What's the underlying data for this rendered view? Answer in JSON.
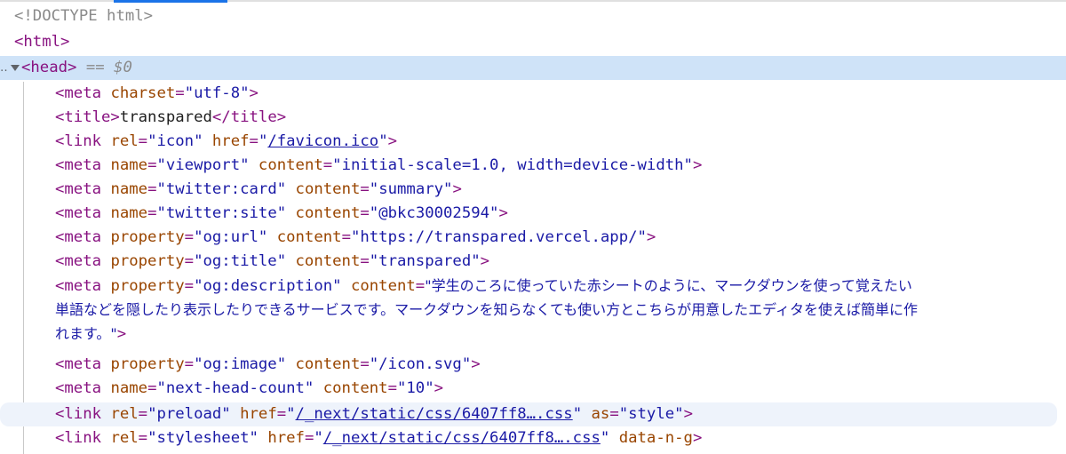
{
  "colors": {
    "tag": "#881280",
    "attr_name": "#994500",
    "attr_value": "#1a1aa6",
    "selected_row": "#cfe3f8",
    "hover_row": "#eef3fb",
    "doctype": "#8a8a8a"
  },
  "lines": {
    "doctype": "<!DOCTYPE html>",
    "html_open": "<html>",
    "head": {
      "dots": "‥",
      "open": "<head>",
      "console_ref": " == $0"
    },
    "meta_charset": {
      "tag": "<meta ",
      "a1": "charset",
      "v1": "\"utf-8\"",
      "close": ">"
    },
    "title": {
      "open": "<title>",
      "text": "transpared",
      "close": "</title>"
    },
    "link_icon": {
      "tag": "<link ",
      "a1": "rel",
      "v1": "\"icon\"",
      "a2": "href",
      "v2_open": "\"",
      "v2_link": "/favicon.ico",
      "v2_close": "\"",
      "close": ">"
    },
    "meta_viewport": {
      "tag": "<meta ",
      "a1": "name",
      "v1": "\"viewport\"",
      "a2": "content",
      "v2": "\"initial-scale=1.0, width=device-width\"",
      "close": ">"
    },
    "meta_twitter_card": {
      "tag": "<meta ",
      "a1": "name",
      "v1": "\"twitter:card\"",
      "a2": "content",
      "v2": "\"summary\"",
      "close": ">"
    },
    "meta_twitter_site": {
      "tag": "<meta ",
      "a1": "name",
      "v1": "\"twitter:site\"",
      "a2": "content",
      "v2": "\"@bkc30002594\"",
      "close": ">"
    },
    "meta_og_url": {
      "tag": "<meta ",
      "a1": "property",
      "v1": "\"og:url\"",
      "a2": "content",
      "v2": "\"https://transpared.vercel.app/\"",
      "close": ">"
    },
    "meta_og_title": {
      "tag": "<meta ",
      "a1": "property",
      "v1": "\"og:title\"",
      "a2": "content",
      "v2": "\"transpared\"",
      "close": ">"
    },
    "meta_og_description": {
      "tag": "<meta ",
      "a1": "property",
      "v1": "\"og:description\"",
      "a2": "content",
      "v2_line1": "\"学生のころに使っていた赤シートのように、マークダウンを使って覚えたい",
      "v2_line2": "単語などを隠したり表示したりできるサービスです。マークダウンを知らなくても使い方とこちらが用意したエディタを使えば簡単に作",
      "v2_line3": "れます。\"",
      "close": ">"
    },
    "meta_og_image": {
      "tag": "<meta ",
      "a1": "property",
      "v1": "\"og:image\"",
      "a2": "content",
      "v2": "\"/icon.svg\"",
      "close": ">"
    },
    "meta_next_head_count": {
      "tag": "<meta ",
      "a1": "name",
      "v1": "\"next-head-count\"",
      "a2": "content",
      "v2": "\"10\"",
      "close": ">"
    },
    "link_preload": {
      "tag": "<link ",
      "a1": "rel",
      "v1": "\"preload\"",
      "a2": "href",
      "v2_open": "\"",
      "v2_link": "/_next/static/css/6407ff8….css",
      "v2_close": "\"",
      "a3": "as",
      "v3": "\"style\"",
      "close": ">"
    },
    "link_stylesheet": {
      "tag": "<link ",
      "a1": "rel",
      "v1": "\"stylesheet\"",
      "a2": "href",
      "v2_open": "\"",
      "v2_link": "/_next/static/css/6407ff8….css",
      "v2_close": "\"",
      "a3": "data-n-g",
      "close": ">"
    }
  }
}
